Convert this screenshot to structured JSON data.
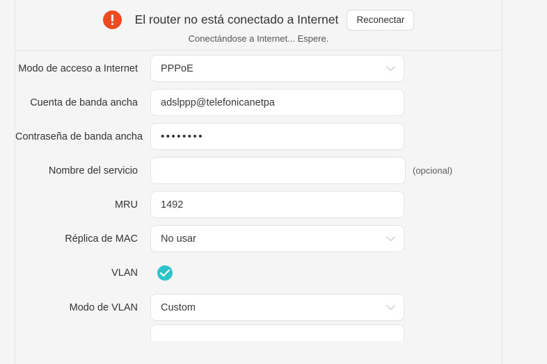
{
  "status": {
    "icon": "alert-exclamation-icon",
    "message": "El router no está conectado a Internet",
    "reconnect_label": "Reconectar",
    "sub_message": "Conectándose a Internet... Espere.",
    "icon_color": "#ee4a20"
  },
  "form": {
    "rows": [
      {
        "label": "Modo de acceso a Internet",
        "type": "select",
        "value": "PPPoE",
        "name": "internet-access-mode"
      },
      {
        "label": "Cuenta de banda ancha",
        "type": "text",
        "value": "adslppp@telefonicanetpa",
        "name": "broadband-account"
      },
      {
        "label": "Contraseña de banda ancha",
        "type": "password",
        "value": "••••••••",
        "name": "broadband-password"
      },
      {
        "label": "Nombre del servicio",
        "type": "text",
        "value": "",
        "note": "(opcional)",
        "name": "service-name"
      },
      {
        "label": "MRU",
        "type": "text",
        "value": "1492",
        "name": "mru"
      },
      {
        "label": "Réplica de MAC",
        "type": "select",
        "value": "No usar",
        "name": "mac-clone"
      },
      {
        "label": "VLAN",
        "type": "checkbox",
        "checked": true,
        "name": "vlan-enable"
      },
      {
        "label": "Modo de VLAN",
        "type": "select",
        "value": "Custom",
        "name": "vlan-mode"
      }
    ]
  },
  "colors": {
    "page_background": "#f5f5f5",
    "field_background": "#ffffff",
    "accent_teal": "#2bc4c8",
    "alert_orange": "#ee4a20",
    "border": "#e3e3e3"
  }
}
